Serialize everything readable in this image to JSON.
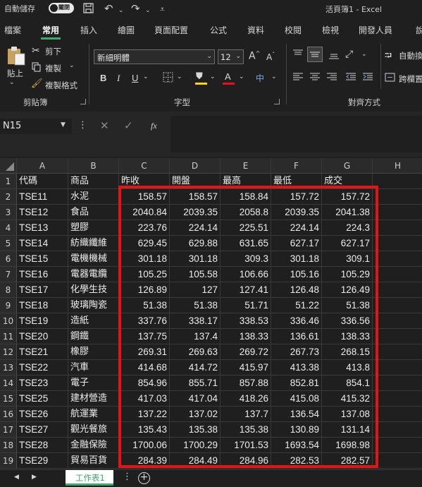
{
  "titlebar": {
    "autosave_label": "自動儲存",
    "autosave_state": "關閉",
    "window_title": "活頁簿1  -  Excel"
  },
  "ribbon_tabs": [
    "檔案",
    "常用",
    "插入",
    "繪圖",
    "頁面配置",
    "公式",
    "資料",
    "校閱",
    "檢視",
    "開發人員",
    "說"
  ],
  "active_tab": "常用",
  "clipboard": {
    "paste": "貼上",
    "cut": "剪下",
    "copy": "複製",
    "format_painter": "複製格式",
    "group_label": "剪貼簿"
  },
  "font": {
    "font_name": "新細明體",
    "font_size": "12",
    "group_label": "字型",
    "font_color": "#e81123",
    "highlight_color": "#ffd700"
  },
  "alignment": {
    "wrap_text": "自動換",
    "merge": "跨欄置",
    "group_label": "對齊方式"
  },
  "formula_bar": {
    "name_box": "N15",
    "fx": "fx",
    "content": ""
  },
  "columns": [
    "A",
    "B",
    "C",
    "D",
    "E",
    "F",
    "G",
    "H"
  ],
  "header_row": [
    "代碼",
    "商品",
    "昨收",
    "開盤",
    "最高",
    "最低",
    "成交"
  ],
  "rows": [
    {
      "num": "2",
      "cells": [
        "TSE11",
        "水泥",
        "158.57",
        "158.57",
        "158.84",
        "157.72",
        "157.72"
      ]
    },
    {
      "num": "3",
      "cells": [
        "TSE12",
        "食品",
        "2040.84",
        "2039.35",
        "2058.8",
        "2039.35",
        "2041.38"
      ]
    },
    {
      "num": "4",
      "cells": [
        "TSE13",
        "塑膠",
        "223.76",
        "224.14",
        "225.51",
        "224.14",
        "224.3"
      ]
    },
    {
      "num": "5",
      "cells": [
        "TSE14",
        "紡織纖維",
        "629.45",
        "629.88",
        "631.65",
        "627.17",
        "627.17"
      ]
    },
    {
      "num": "6",
      "cells": [
        "TSE15",
        "電機機械",
        "301.18",
        "301.18",
        "309.3",
        "301.18",
        "309.1"
      ]
    },
    {
      "num": "7",
      "cells": [
        "TSE16",
        "電器電纜",
        "105.25",
        "105.58",
        "106.66",
        "105.16",
        "105.29"
      ]
    },
    {
      "num": "8",
      "cells": [
        "TSE17",
        "化學生技",
        "126.89",
        "127",
        "127.41",
        "126.48",
        "126.49"
      ]
    },
    {
      "num": "9",
      "cells": [
        "TSE18",
        "玻璃陶瓷",
        "51.38",
        "51.38",
        "51.71",
        "51.22",
        "51.38"
      ]
    },
    {
      "num": "10",
      "cells": [
        "TSE19",
        "造紙",
        "337.76",
        "338.17",
        "338.53",
        "336.46",
        "336.56"
      ]
    },
    {
      "num": "11",
      "cells": [
        "TSE20",
        "鋼鐵",
        "137.75",
        "137.4",
        "138.33",
        "136.61",
        "138.33"
      ]
    },
    {
      "num": "12",
      "cells": [
        "TSE21",
        "橡膠",
        "269.31",
        "269.63",
        "269.72",
        "267.73",
        "268.15"
      ]
    },
    {
      "num": "13",
      "cells": [
        "TSE22",
        "汽車",
        "414.68",
        "414.72",
        "415.97",
        "413.38",
        "413.8"
      ]
    },
    {
      "num": "14",
      "cells": [
        "TSE23",
        "電子",
        "854.96",
        "855.71",
        "857.88",
        "852.81",
        "854.1"
      ]
    },
    {
      "num": "15",
      "cells": [
        "TSE25",
        "建材營造",
        "417.03",
        "417.04",
        "418.26",
        "415.08",
        "415.32"
      ]
    },
    {
      "num": "16",
      "cells": [
        "TSE26",
        "航運業",
        "137.22",
        "137.02",
        "137.7",
        "136.54",
        "137.08"
      ]
    },
    {
      "num": "17",
      "cells": [
        "TSE27",
        "觀光餐旅",
        "135.43",
        "135.38",
        "135.38",
        "130.89",
        "131.14"
      ]
    },
    {
      "num": "18",
      "cells": [
        "TSE28",
        "金融保險",
        "1700.06",
        "1700.29",
        "1701.53",
        "1693.54",
        "1698.98"
      ]
    },
    {
      "num": "19",
      "cells": [
        "TSE29",
        "貿易百貨",
        "284.39",
        "284.49",
        "284.96",
        "282.53",
        "282.57"
      ]
    }
  ],
  "sheet_tabs": [
    "工作表1"
  ],
  "highlight_color": "#e11515",
  "accent_color": "#3fa86b"
}
